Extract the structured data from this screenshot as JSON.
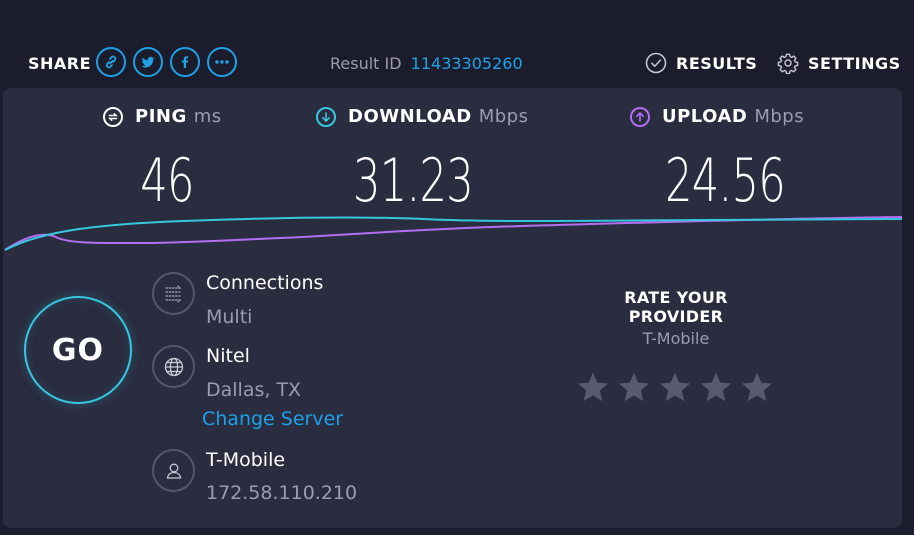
{
  "header": {
    "share_label": "SHARE",
    "share_buttons": [
      {
        "icon": "link-icon"
      },
      {
        "icon": "twitter-icon"
      },
      {
        "icon": "facebook-icon"
      },
      {
        "icon": "more-icon"
      }
    ],
    "result_id_label": "Result ID",
    "result_id_value": "11433305260",
    "results_label": "RESULTS",
    "settings_label": "SETTINGS"
  },
  "metrics": {
    "ping": {
      "label": "PING",
      "unit": "ms",
      "value": "46",
      "color": "#ffffff"
    },
    "download": {
      "label": "DOWNLOAD",
      "unit": "Mbps",
      "value": "31.23",
      "color": "#37c7e0"
    },
    "upload": {
      "label": "UPLOAD",
      "unit": "Mbps",
      "value": "24.56",
      "color": "#b46ef2"
    }
  },
  "go_label": "GO",
  "connection": {
    "connections_title": "Connections",
    "connections_value": "Multi",
    "server_name": "Nitel",
    "server_location": "Dallas, TX",
    "change_server_label": "Change Server",
    "isp_name": "T-Mobile",
    "ip_address": "172.58.110.210"
  },
  "rating": {
    "title": "RATE YOUR PROVIDER",
    "provider": "T-Mobile",
    "stars": 5,
    "star_color": "#585a6e"
  },
  "colors": {
    "accent": "#1ea1e6",
    "download_line": "#37c7e0",
    "upload_line": "#b46ef2",
    "panel": "#2a2c40",
    "background": "#1c1d2c"
  }
}
